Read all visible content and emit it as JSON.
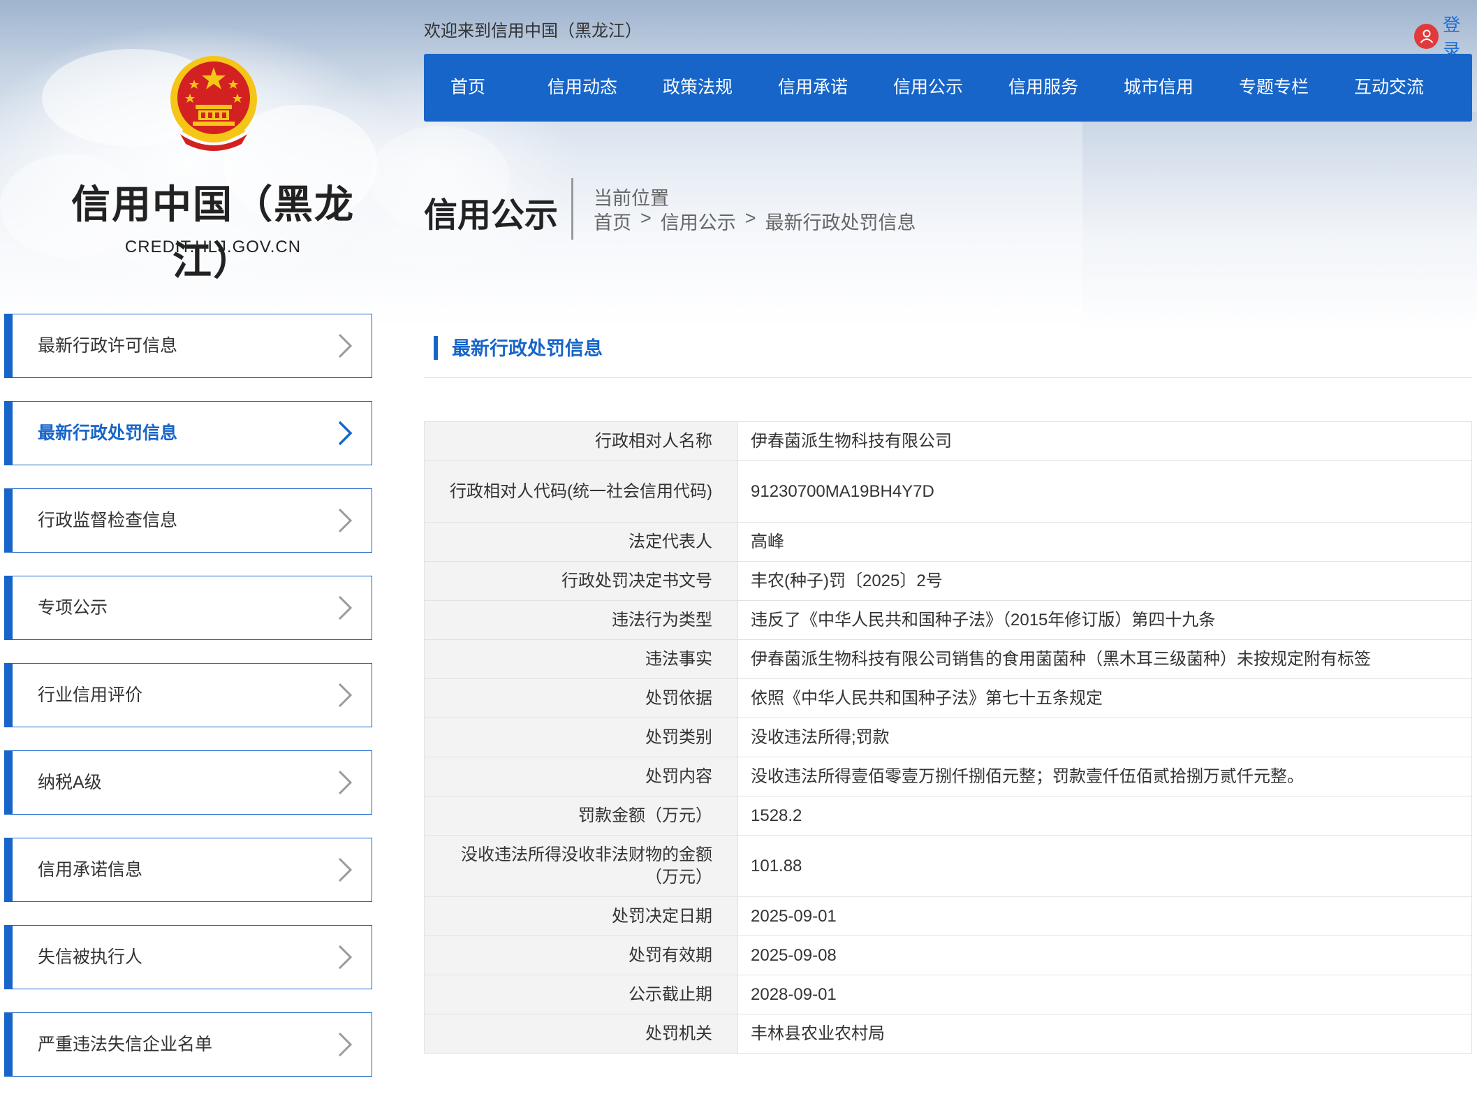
{
  "header": {
    "welcome": "欢迎来到信用中国（黑龙江）",
    "login_label": "登录",
    "site_title": "信用中国（黑龙江）",
    "site_domain": "CREDIT.HLJ.GOV.CN"
  },
  "nav": {
    "items": [
      {
        "label": "首页"
      },
      {
        "label": "信用动态"
      },
      {
        "label": "政策法规"
      },
      {
        "label": "信用承诺"
      },
      {
        "label": "信用公示"
      },
      {
        "label": "信用服务"
      },
      {
        "label": "城市信用"
      },
      {
        "label": "专题专栏"
      },
      {
        "label": "互动交流"
      }
    ]
  },
  "section": {
    "title": "信用公示",
    "location_label": "当前位置",
    "breadcrumb": [
      "首页",
      "信用公示",
      "最新行政处罚信息"
    ],
    "breadcrumb_sep": ">"
  },
  "sidebar": {
    "items": [
      {
        "label": "最新行政许可信息",
        "active": false
      },
      {
        "label": "最新行政处罚信息",
        "active": true
      },
      {
        "label": "行政监督检查信息",
        "active": false
      },
      {
        "label": "专项公示",
        "active": false
      },
      {
        "label": "行业信用评价",
        "active": false
      },
      {
        "label": "纳税A级",
        "active": false
      },
      {
        "label": "信用承诺信息",
        "active": false
      },
      {
        "label": "失信被执行人",
        "active": false
      },
      {
        "label": "严重违法失信企业名单",
        "active": false
      }
    ]
  },
  "content": {
    "title": "最新行政处罚信息",
    "rows": [
      {
        "key": "行政相对人名称",
        "value": "伊春菌派生物科技有限公司"
      },
      {
        "key": "行政相对人代码(统一社会信用代码)",
        "value": "91230700MA19BH4Y7D"
      },
      {
        "key": "法定代表人",
        "value": "高峰"
      },
      {
        "key": "行政处罚决定书文号",
        "value": "丰农(种子)罚〔2025〕2号"
      },
      {
        "key": "违法行为类型",
        "value": "违反了《中华人民共和国种子法》（2015年修订版）第四十九条"
      },
      {
        "key": "违法事实",
        "value": "伊春菌派生物科技有限公司销售的食用菌菌种（黑木耳三级菌种）未按规定附有标签"
      },
      {
        "key": "处罚依据",
        "value": "依照《中华人民共和国种子法》第七十五条规定"
      },
      {
        "key": "处罚类别",
        "value": "没收违法所得;罚款"
      },
      {
        "key": "处罚内容",
        "value": "没收违法所得壹佰零壹万捌仟捌佰元整；罚款壹仟伍佰贰拾捌万贰仟元整。"
      },
      {
        "key": "罚款金额（万元）",
        "value": "1528.2"
      },
      {
        "key": "没收违法所得没收非法财物的金额（万元）",
        "value": "101.88"
      },
      {
        "key": "处罚决定日期",
        "value": "2025-09-01"
      },
      {
        "key": "处罚有效期",
        "value": "2025-09-08"
      },
      {
        "key": "公示截止期",
        "value": "2028-09-01"
      },
      {
        "key": "处罚机关",
        "value": "丰林县农业农村局"
      }
    ]
  },
  "colors": {
    "primary": "#1765c8",
    "emblem_red": "#d32121",
    "emblem_gold": "#f5c518",
    "login_icon": "#e23a3a",
    "key_cell_bg": "#f3f3f3",
    "border": "#e2e2e2"
  },
  "icons": {
    "emblem": "national-emblem-icon",
    "login": "user-icon",
    "sidebar_arrow": "chevron-right-icon"
  }
}
